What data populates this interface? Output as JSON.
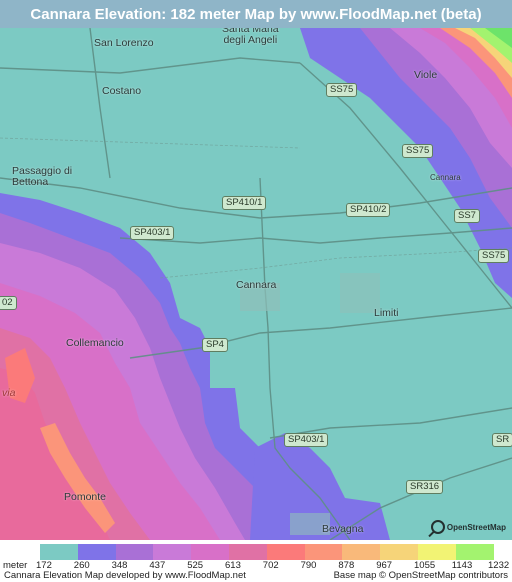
{
  "title": "Cannara Elevation: 182 meter Map by www.FloodMap.net (beta)",
  "places": {
    "san_lorenzo": "San Lorenzo",
    "santa_maria": "Santa Maria\ndegli Angeli",
    "viole": "Viole",
    "costano": "Costano",
    "passaggio": "Passaggio di\nBettona",
    "cannara": "Cannara",
    "cannara_small": "Cannara",
    "limiti": "Limiti",
    "collemancio": "Collemancio",
    "pomonte": "Pomonte",
    "bevagna": "Bevagna",
    "via": "via"
  },
  "roads": {
    "ss75_a": "SS75",
    "ss75_b": "SS75",
    "ss75_c": "SS7",
    "ss75_d": "SS75",
    "sp410_1": "SP410/1",
    "sp410_2": "SP410/2",
    "sp403_1a": "SP403/1",
    "sp403_1b": "SP403/1",
    "sp4": "SP4",
    "sr316": "SR316",
    "s02": "02",
    "s_right": "SR"
  },
  "legend": {
    "unit_label": "meter",
    "values": [
      "172",
      "260",
      "348",
      "437",
      "525",
      "613",
      "702",
      "790",
      "878",
      "967",
      "1055",
      "1143",
      "1232"
    ],
    "colors": [
      "#7ccac3",
      "#7f73e8",
      "#a970d6",
      "#c97ad8",
      "#d870c8",
      "#e071a5",
      "#fb7a7a",
      "#fb957a",
      "#f9b97a",
      "#f6d479",
      "#f2f374",
      "#a3f36f",
      "#6de36a"
    ]
  },
  "footer": {
    "left": "Cannara Elevation Map developed by www.FloodMap.net",
    "right": "Base map © OpenStreetMap contributors"
  },
  "osm_logo_text": "OpenStreetMap"
}
